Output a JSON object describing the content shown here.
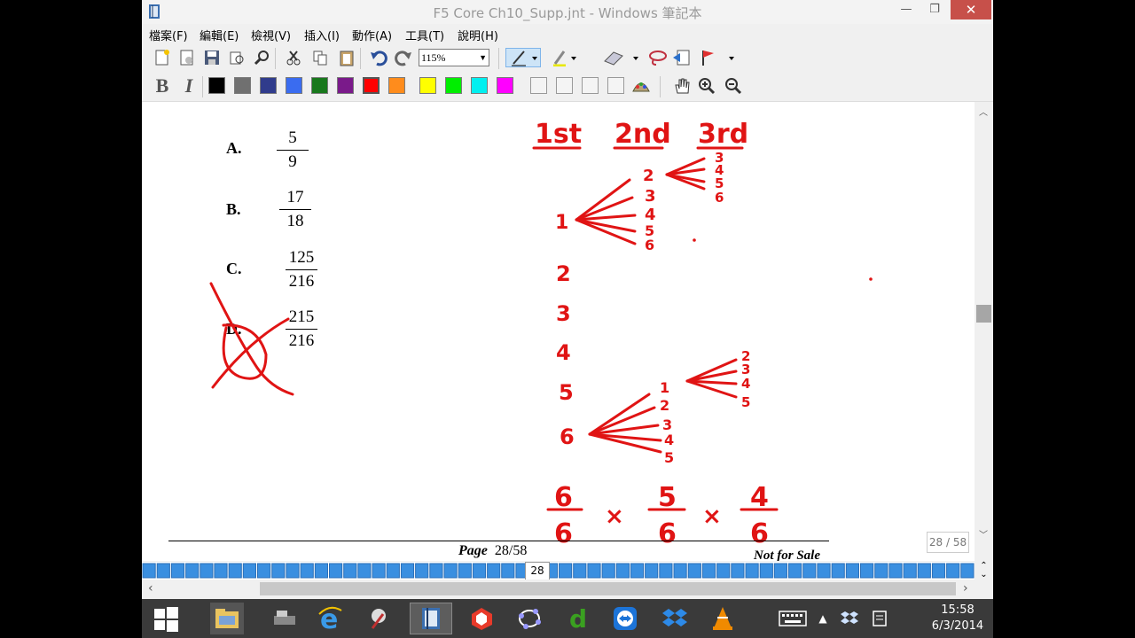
{
  "window": {
    "title": "F5 Core Ch10_Supp.jnt - Windows 筆記本"
  },
  "menu": {
    "file": "檔案(F)",
    "edit": "編輯(E)",
    "view": "檢視(V)",
    "insert": "插入(I)",
    "actions": "動作(A)",
    "tools": "工具(T)",
    "help": "說明(H)"
  },
  "toolbar": {
    "zoom": "115%",
    "swatches": [
      "#000000",
      "#707070",
      "#303c8c",
      "#3a6cf0",
      "#18781c",
      "#7a1a8a",
      "#ff0000",
      "#ff8c1c",
      "#ffff00",
      "#00ee00",
      "#00f0f0",
      "#ff00ff"
    ]
  },
  "question": {
    "options": [
      {
        "label": "A.",
        "num": "5",
        "den": "9"
      },
      {
        "label": "B.",
        "num": "17",
        "den": "18"
      },
      {
        "label": "C.",
        "num": "125",
        "den": "216"
      },
      {
        "label": "D.",
        "num": "215",
        "den": "216"
      }
    ]
  },
  "ink": {
    "color": "#e01414",
    "headers": [
      "1st",
      "2nd",
      "3rd"
    ],
    "first_branch": {
      "root": "1",
      "children": [
        "2",
        "3",
        "4",
        "5",
        "6"
      ],
      "sub_root": "2",
      "sub_children": [
        "3",
        "4",
        "5",
        "6"
      ]
    },
    "first_column": [
      "2",
      "3",
      "4",
      "5",
      "6"
    ],
    "sixth_branch": {
      "root": "6",
      "children": [
        "1",
        "2",
        "3",
        "4",
        "5"
      ],
      "sub_root": "1",
      "sub_children": [
        "2",
        "3",
        "4",
        "5"
      ]
    },
    "product": [
      {
        "num": "6",
        "den": "6"
      },
      {
        "num": "5",
        "den": "6"
      },
      {
        "num": "4",
        "den": "6"
      }
    ],
    "times": "×"
  },
  "footer": {
    "page_label": "Page",
    "page_number": "28/58",
    "not_for_sale": "Not for Sale",
    "page_indicator": "28 / 58",
    "nav_current": "28"
  },
  "taskbar": {
    "time": "15:58",
    "date": "6/3/2014"
  }
}
